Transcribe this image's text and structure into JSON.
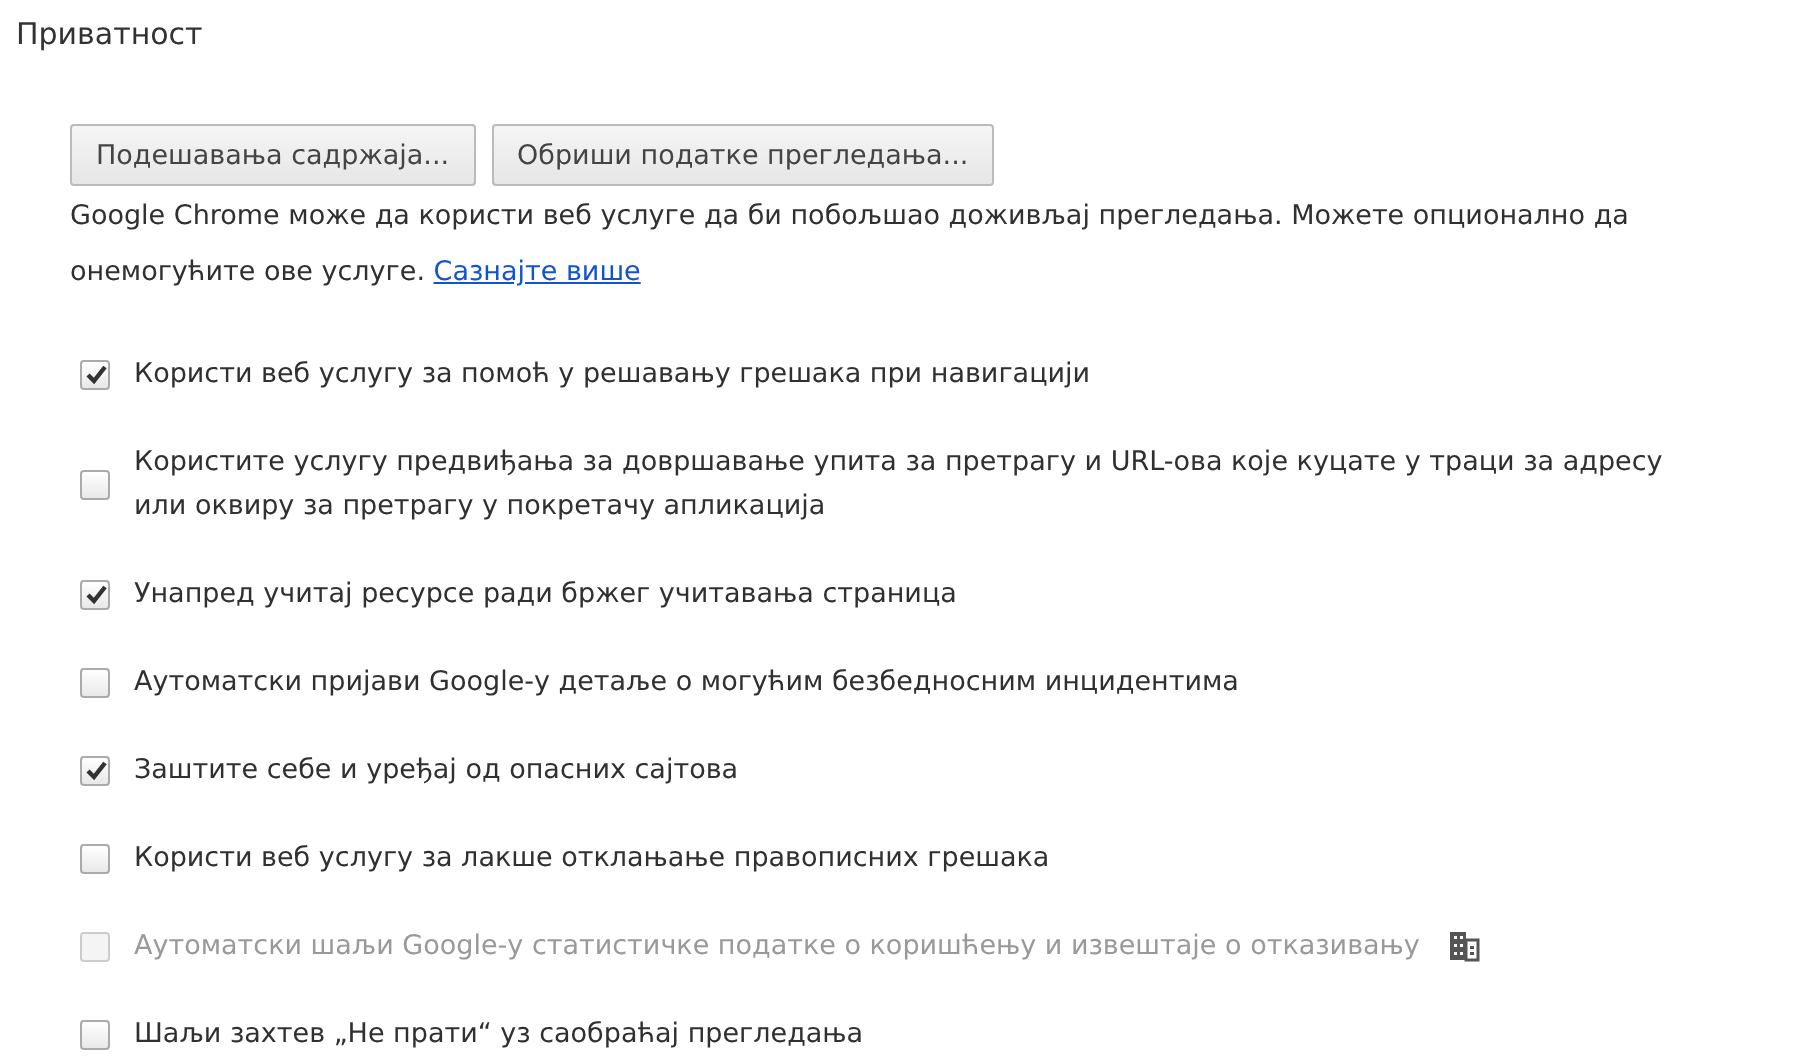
{
  "section": {
    "title": "Приватност"
  },
  "buttons": [
    "Подешавања садржаја...",
    "Обриши податке прегледања..."
  ],
  "description": {
    "text": "Google Chrome може да користи веб услуге да би побољшао доживљај прегледања. Можете опционално да онемогућите ове услуге.",
    "link": "Сазнајте више"
  },
  "options": [
    {
      "label": "Користи веб услугу за помоћ у решавању грешака при навигацији",
      "checked": true,
      "disabled": false,
      "managed": false
    },
    {
      "label": "Користите услугу предвиђања за довршавање упита за претрагу и URL-ова које куцате у траци за адресу или оквиру за претрагу у покретачу апликација",
      "checked": false,
      "disabled": false,
      "managed": false
    },
    {
      "label": "Унапред учитај ресурсе ради бржег учитавања страница",
      "checked": true,
      "disabled": false,
      "managed": false
    },
    {
      "label": "Аутоматски пријави Google-у детаље о могућим безбедносним инцидентима",
      "checked": false,
      "disabled": false,
      "managed": false
    },
    {
      "label": "Заштите себе и уређај од опасних сајтова",
      "checked": true,
      "disabled": false,
      "managed": false
    },
    {
      "label": "Користи веб услугу за лакше отклањање правописних грешака",
      "checked": false,
      "disabled": false,
      "managed": false
    },
    {
      "label": "Аутоматски шаљи Google-у статистичке податке о коришћењу и извештаје о отказивању",
      "checked": false,
      "disabled": true,
      "managed": true
    },
    {
      "label": "Шаљи захтев „Не прати“ уз саобраћај прегледања",
      "checked": false,
      "disabled": false,
      "managed": false
    }
  ]
}
